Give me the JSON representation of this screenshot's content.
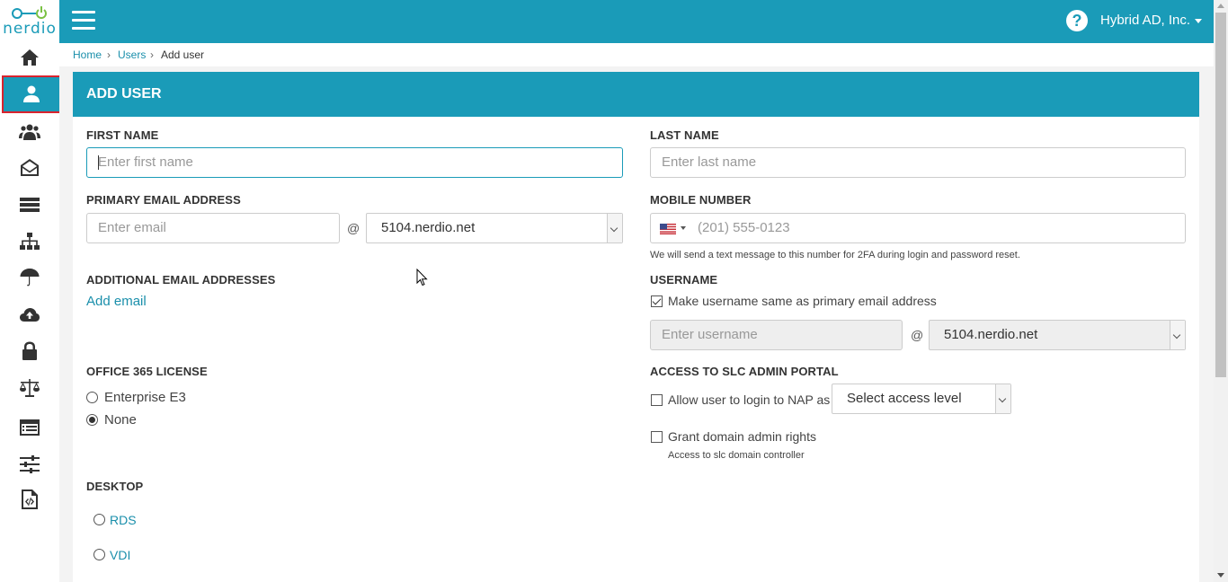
{
  "brand": {
    "name": "nerdio",
    "accent": "#1a9bb8",
    "highlight": "#d9232e"
  },
  "topbar": {
    "menu_icon": "hamburger-icon",
    "help_icon": "?",
    "org_name": "Hybrid AD, Inc."
  },
  "sidebar": {
    "items": [
      {
        "icon": "home-icon"
      },
      {
        "icon": "user-icon",
        "active": true
      },
      {
        "icon": "users-group-icon"
      },
      {
        "icon": "envelope-open-icon"
      },
      {
        "icon": "server-icon"
      },
      {
        "icon": "sitemap-icon"
      },
      {
        "icon": "umbrella-icon"
      },
      {
        "icon": "cloud-upload-icon"
      },
      {
        "icon": "lock-icon"
      },
      {
        "icon": "balance-scale-icon"
      },
      {
        "icon": "list-icon"
      },
      {
        "icon": "sliders-icon"
      },
      {
        "icon": "code-file-icon"
      }
    ]
  },
  "breadcrumb": {
    "home": "Home",
    "sep": "›",
    "users": "Users",
    "current": "Add user"
  },
  "panel": {
    "title": "ADD USER"
  },
  "form": {
    "first_name": {
      "label": "FIRST NAME",
      "placeholder": "Enter first name"
    },
    "last_name": {
      "label": "LAST NAME",
      "placeholder": "Enter last name"
    },
    "primary_email": {
      "label": "PRIMARY EMAIL ADDRESS",
      "placeholder": "Enter email",
      "at": "@",
      "domain": "5104.nerdio.net"
    },
    "mobile": {
      "label": "MOBILE NUMBER",
      "placeholder": "(201) 555-0123",
      "country_flag": "us-flag-icon",
      "hint": "We will send a text message to this number for 2FA during login and password reset."
    },
    "additional_emails": {
      "label": "ADDITIONAL EMAIL ADDRESSES",
      "add_link": "Add email"
    },
    "username": {
      "label": "USERNAME",
      "same_as_email": "Make username same as primary email address",
      "same_checked": true,
      "placeholder": "Enter username",
      "at": "@",
      "domain": "5104.nerdio.net"
    },
    "license": {
      "label": "OFFICE 365 LICENSE",
      "options": [
        "Enterprise E3",
        "None"
      ],
      "selected": "None"
    },
    "slc_admin": {
      "label": "ACCESS TO SLC ADMIN PORTAL",
      "allow_login": "Allow user to login to NAP as",
      "access_level": "Select access level",
      "grant_admin": "Grant domain admin rights",
      "grant_hint": "Access to slc domain controller"
    },
    "desktop": {
      "label": "DESKTOP",
      "options": [
        "RDS",
        "VDI"
      ]
    }
  }
}
